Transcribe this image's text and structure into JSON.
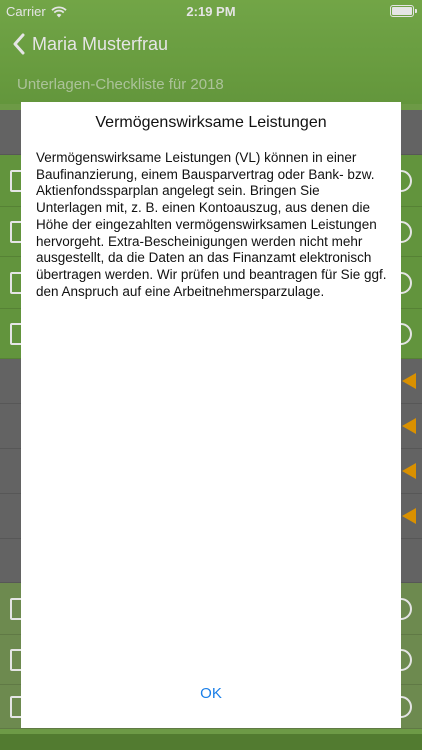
{
  "status_bar": {
    "carrier": "Carrier",
    "time": "2:19 PM"
  },
  "nav": {
    "back_label": "Maria Musterfrau"
  },
  "header": {
    "subtitle": "Unterlagen-Checkliste für 2018"
  },
  "background_rows": [
    {
      "style": "dark",
      "checkbox": false,
      "marker": "none",
      "h": 45
    },
    {
      "style": "green",
      "checkbox": true,
      "marker": "circle",
      "h": 52
    },
    {
      "style": "green",
      "checkbox": true,
      "marker": "circle",
      "h": 50
    },
    {
      "style": "green",
      "checkbox": true,
      "marker": "circle",
      "h": 52
    },
    {
      "style": "green",
      "checkbox": true,
      "marker": "circle",
      "h": 50
    },
    {
      "style": "dark",
      "checkbox": false,
      "marker": "triangle",
      "h": 45
    },
    {
      "style": "dark",
      "checkbox": false,
      "marker": "triangle",
      "h": 45
    },
    {
      "style": "dark",
      "checkbox": false,
      "marker": "triangle",
      "h": 45
    },
    {
      "style": "dark",
      "checkbox": false,
      "marker": "triangle",
      "h": 45
    },
    {
      "style": "dark",
      "checkbox": false,
      "marker": "none",
      "h": 44
    },
    {
      "style": "olive",
      "checkbox": true,
      "marker": "circle",
      "h": 52
    },
    {
      "style": "olive",
      "checkbox": true,
      "marker": "circle",
      "h": 50
    },
    {
      "style": "olive",
      "checkbox": true,
      "marker": "circle",
      "h": 44
    }
  ],
  "modal": {
    "title": "Vermögenswirksame Leistungen",
    "body": "Vermögenswirksame Leistungen (VL) können in einer Baufinanzierung, einem Bausparvertrag oder Bank- bzw. Aktienfondssparplan angelegt sein. Bringen Sie Unterlagen mit, z. B. einen Kontoauszug, aus denen die Höhe der eingezahlten vermögenswirksamen Leistungen hervorgeht. Extra-Bescheinigungen werden nicht mehr ausgestellt, da die Daten an das Finanzamt elektronisch übertragen werden. Wir prüfen und beantragen für Sie ggf. den Anspruch auf eine Arbeitnehmersparzulage.",
    "ok_label": "OK"
  },
  "colors": {
    "accent": "#1a7fe8",
    "header_green": "#7fb84f",
    "row_green": "#6ea544",
    "row_dark": "#6f6f6f",
    "warning_orange": "#f2a100"
  }
}
